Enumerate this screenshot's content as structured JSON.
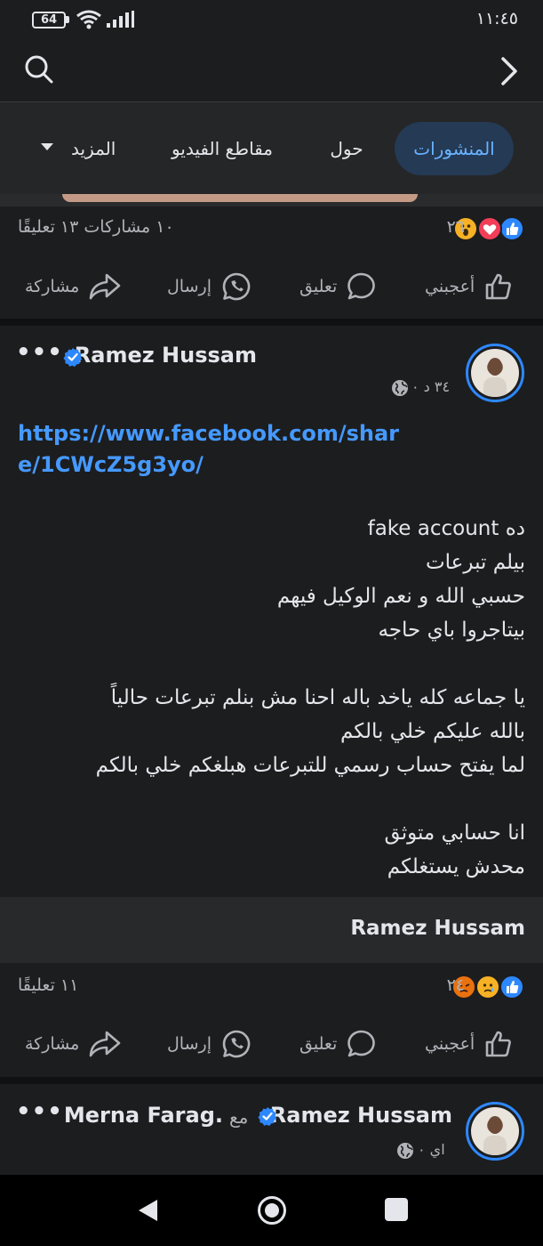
{
  "status_bar": {
    "time": "١١:٤٥",
    "battery": "64"
  },
  "tabs": {
    "posts": "المنشورات",
    "about": "حول",
    "videos": "مقاطع الفيديو",
    "more": "المزيد"
  },
  "post1": {
    "reaction_count": "٢٦",
    "comments": "١٣ تعليقًا",
    "shares": "١٠ مشاركات",
    "actions": {
      "like": "أعجبني",
      "comment": "تعليق",
      "send": "إرسال",
      "share": "مشاركة"
    }
  },
  "post2": {
    "author": "Ramez Hussam",
    "meta": "٣٤ د ٠",
    "link": "https://www.facebook.com/share/1CWcZ5g3yo/",
    "body_lines": [
      "ده fake account",
      "بيلم تبرعات",
      "حسبي الله  و نعم الوكيل فيهم",
      "بيتاجروا باي حاجه",
      "",
      "يا جماعه كله ياخد باله احنا مش بنلم تبرعات حالياً",
      "بالله عليكم خلي بالكم",
      "لما يفتح حساب رسمي للتبرعات هبلغكم خلي بالكم",
      "",
      "انا حسابي متوثق",
      "محدش يستغلكم"
    ],
    "shared_name": "Ramez Hussam",
    "reaction_count": "٢٤",
    "comments": "١١ تعليقًا",
    "actions": {
      "like": "أعجبني",
      "comment": "تعليق",
      "send": "إرسال",
      "share": "مشاركة"
    }
  },
  "post3": {
    "author": "Ramez Hussam",
    "with_word": "مع",
    "tagged": "Merna Farag.",
    "meta": "اي ٠"
  },
  "colors": {
    "accent": "#2d88ff",
    "link": "#4599ff",
    "background": "#1c1d1f"
  }
}
